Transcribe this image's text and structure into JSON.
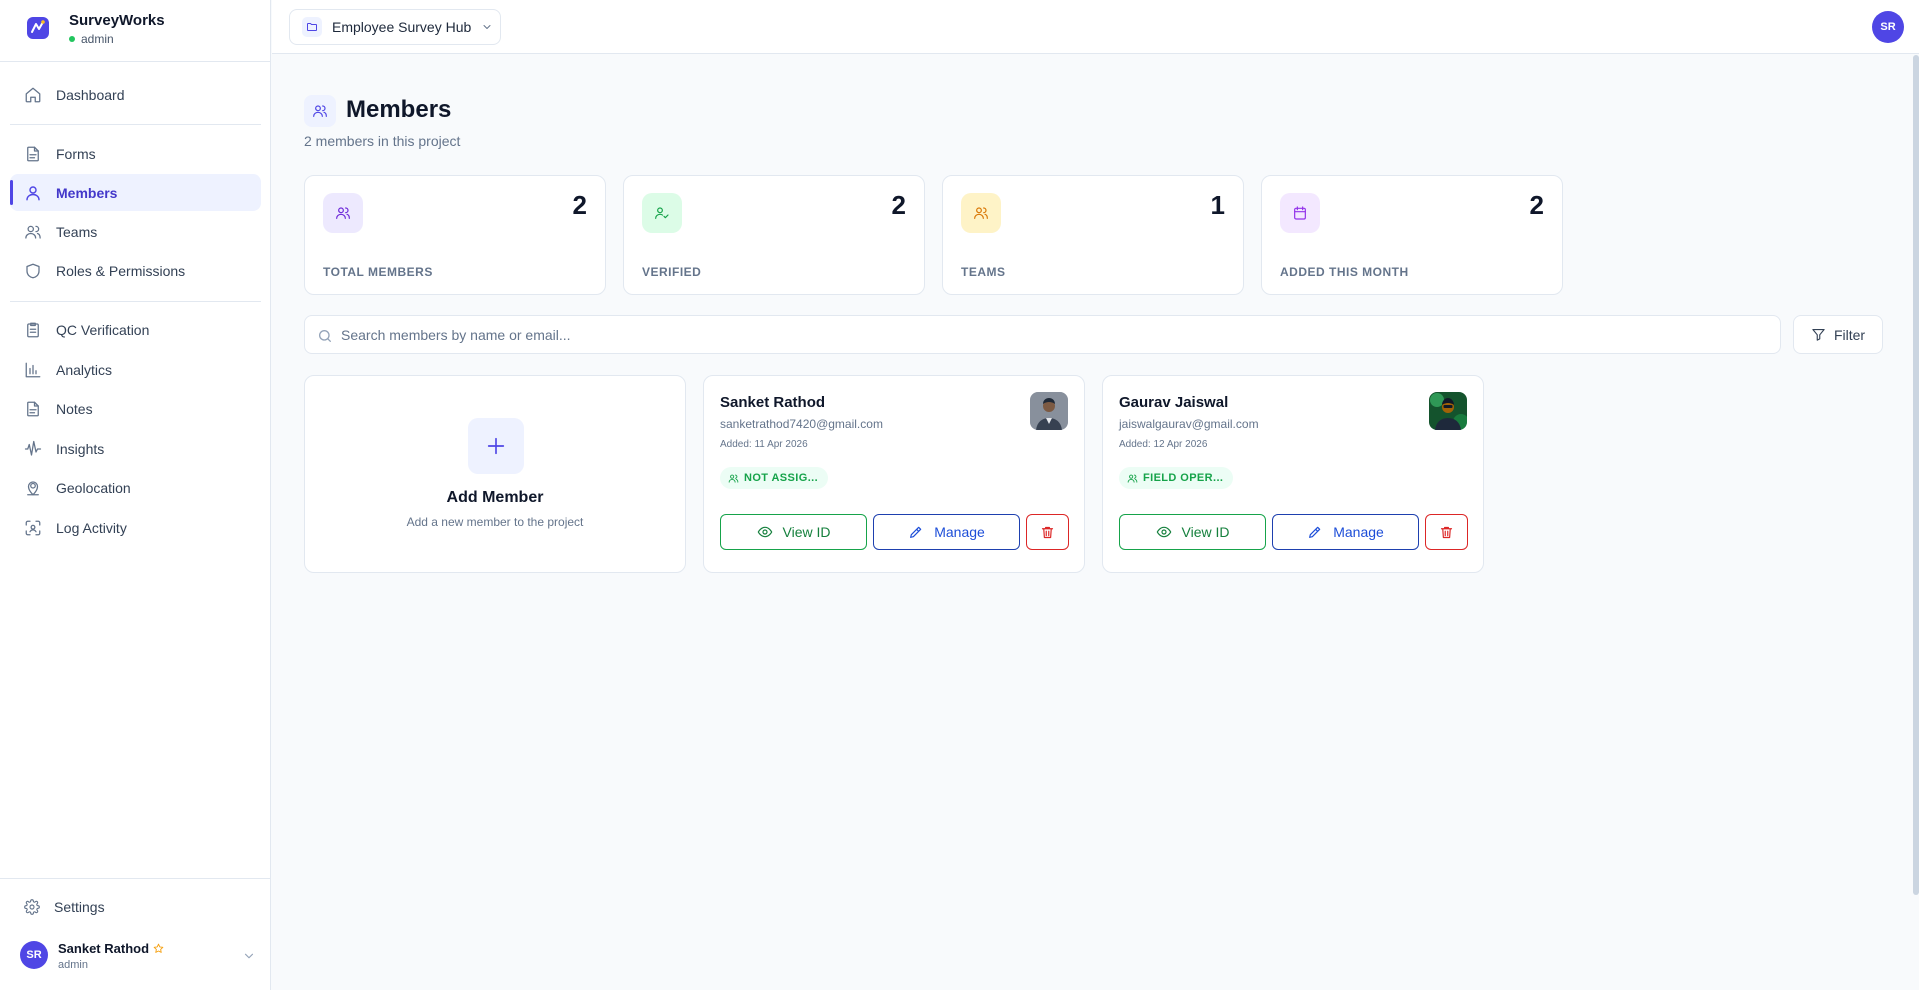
{
  "brand": {
    "name": "SurveyWorks",
    "role": "admin"
  },
  "nav": {
    "items": [
      {
        "id": "dashboard",
        "label": "Dashboard",
        "icon": "home-icon"
      },
      {
        "id": "forms",
        "label": "Forms",
        "icon": "file-icon"
      },
      {
        "id": "members",
        "label": "Members",
        "icon": "user-icon",
        "active": true
      },
      {
        "id": "teams",
        "label": "Teams",
        "icon": "users-icon"
      },
      {
        "id": "roles",
        "label": "Roles & Permissions",
        "icon": "shield-icon"
      },
      {
        "id": "qc",
        "label": "QC Verification",
        "icon": "clipboard-icon"
      },
      {
        "id": "analytics",
        "label": "Analytics",
        "icon": "bar-chart-icon"
      },
      {
        "id": "notes",
        "label": "Notes",
        "icon": "file-icon"
      },
      {
        "id": "insights",
        "label": "Insights",
        "icon": "waveform-icon"
      },
      {
        "id": "geolocation",
        "label": "Geolocation",
        "icon": "map-pin-icon"
      },
      {
        "id": "log",
        "label": "Log Activity",
        "icon": "scan-icon"
      }
    ],
    "settings_label": "Settings"
  },
  "user": {
    "initials": "SR",
    "name": "Sanket Rathod",
    "role": "admin"
  },
  "header": {
    "project": "Employee Survey Hub",
    "avatar_initials": "SR"
  },
  "page": {
    "title": "Members",
    "subtitle": "2 members in this project"
  },
  "stats": [
    {
      "label": "TOTAL MEMBERS",
      "value": "2",
      "bg": "#ede9fe",
      "color": "#6d28d9"
    },
    {
      "label": "VERIFIED",
      "value": "2",
      "bg": "#dcfce7",
      "color": "#16a34a"
    },
    {
      "label": "TEAMS",
      "value": "1",
      "bg": "#fef3c7",
      "color": "#d97706"
    },
    {
      "label": "ADDED THIS MONTH",
      "value": "2",
      "bg": "#f3e8ff",
      "color": "#9333ea"
    }
  ],
  "search": {
    "placeholder": "Search members by name or email..."
  },
  "filter_label": "Filter",
  "add_card": {
    "title": "Add Member",
    "subtitle": "Add a new member to the project"
  },
  "members": [
    {
      "name": "Sanket Rathod",
      "email": "sanketrathod7420@gmail.com",
      "added": "Added: 11 Apr 2026",
      "badge": "NOT ASSIG...",
      "view_label": "View ID",
      "manage_label": "Manage"
    },
    {
      "name": "Gaurav Jaiswal",
      "email": "jaiswalgaurav@gmail.com",
      "added": "Added: 12 Apr 2026",
      "badge": "FIELD OPER...",
      "view_label": "View ID",
      "manage_label": "Manage"
    }
  ],
  "colors": {
    "accent": "#4f46e5",
    "success": "#16a34a",
    "danger": "#dc2626",
    "manage": "#1d4ed8"
  }
}
